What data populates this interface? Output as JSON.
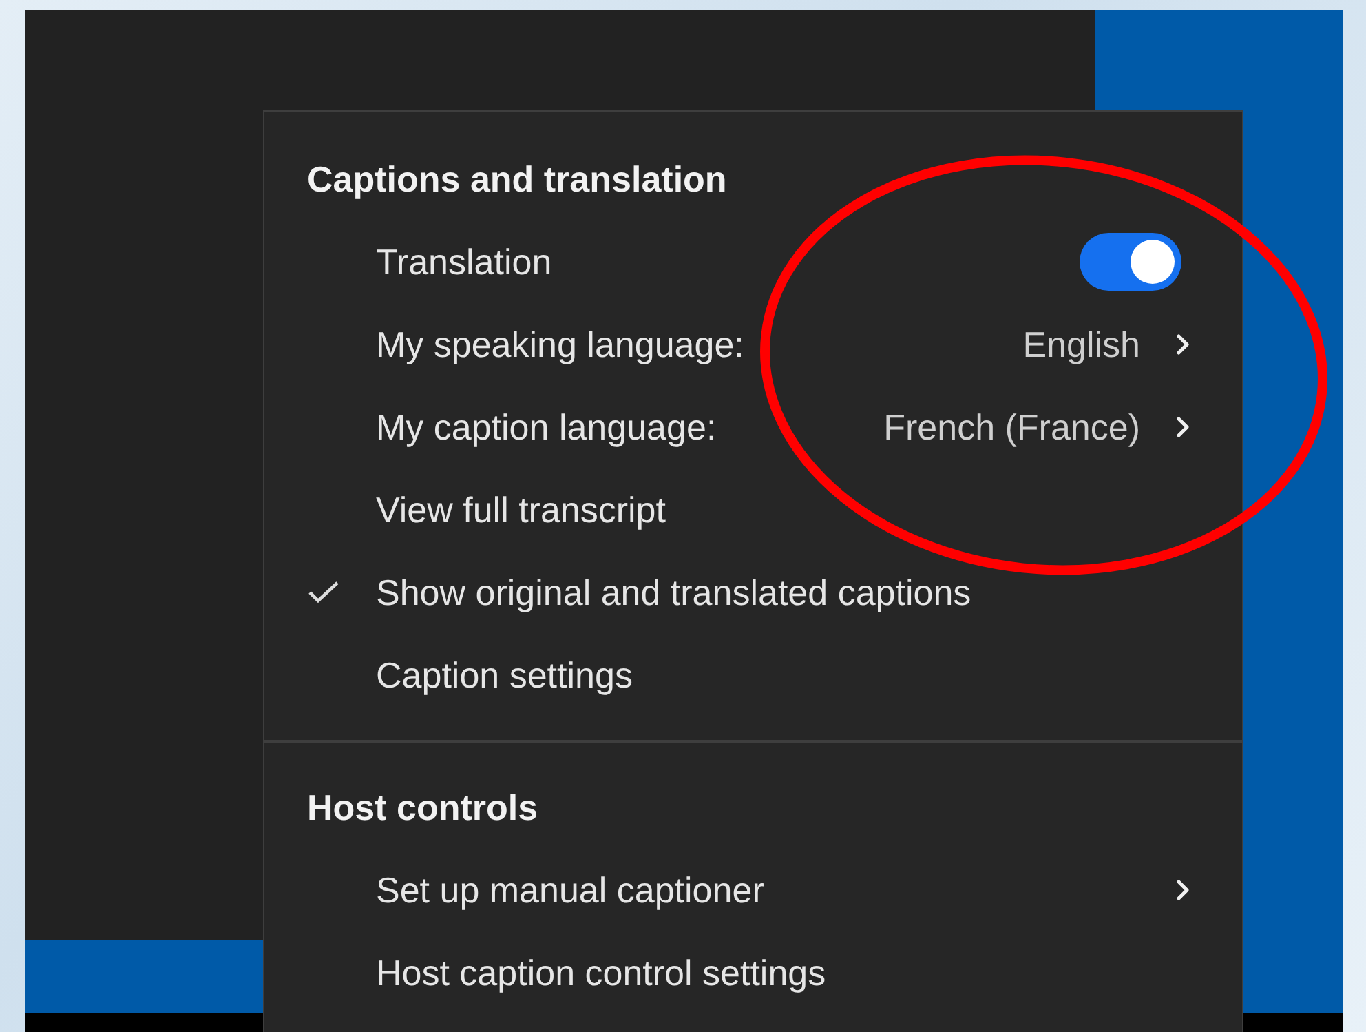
{
  "menu": {
    "sections": [
      {
        "title": "Captions and translation",
        "items": [
          {
            "kind": "toggle",
            "label": "Translation",
            "on": true
          },
          {
            "kind": "submenu",
            "label": "My speaking language:",
            "value": "English"
          },
          {
            "kind": "submenu",
            "label": "My caption language:",
            "value": "French (France)"
          },
          {
            "kind": "plain",
            "label": "View full transcript"
          },
          {
            "kind": "check",
            "label": "Show original and translated captions",
            "checked": true
          },
          {
            "kind": "plain",
            "label": "Caption settings"
          }
        ]
      },
      {
        "title": "Host controls",
        "items": [
          {
            "kind": "submenu",
            "label": "Set up manual captioner"
          },
          {
            "kind": "plain",
            "label": "Host caption control settings"
          }
        ]
      }
    ]
  }
}
